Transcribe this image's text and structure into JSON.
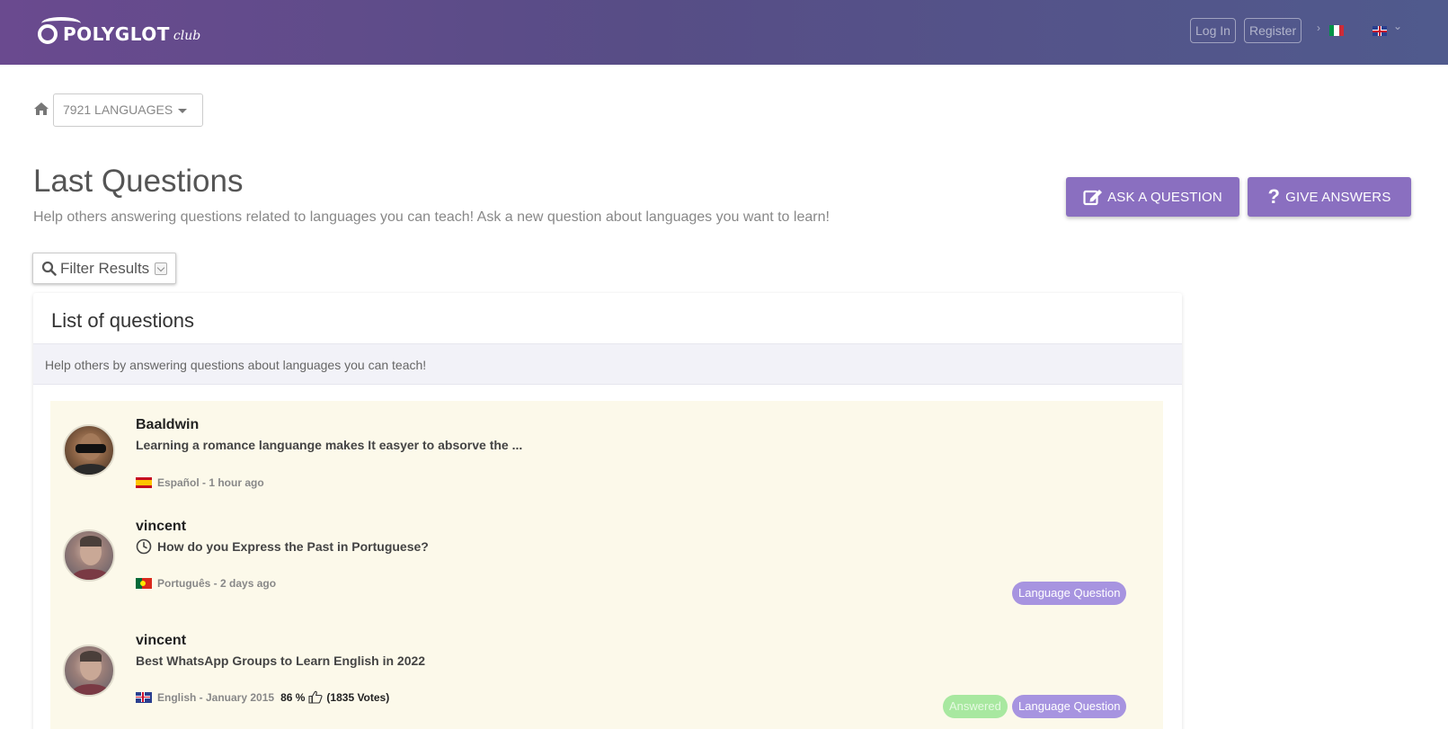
{
  "header": {
    "logo_text": "POLYGLOT",
    "logo_sub": "club",
    "login_label": "Log In",
    "register_label": "Register",
    "chevron": "›",
    "lang_chevron": "⌄"
  },
  "breadcrumb": {
    "languages_label": "7921 LANGUAGES"
  },
  "page": {
    "title": "Last Questions",
    "subtitle": "Help others answering questions related to languages you can teach! Ask a new question about languages you want to learn!",
    "ask_label": "ASK A QUESTION",
    "give_label": "GIVE ANSWERS"
  },
  "filter": {
    "label": "Filter Results"
  },
  "panel": {
    "title": "List of questions",
    "hint": "Help others by answering questions about languages you can teach!"
  },
  "questions": [
    {
      "user": "Baaldwin",
      "text": "Learning a romance languange makes It easyer to absorve the ...",
      "meta": "Español - 1 hour ago",
      "flag": "es-flag-icon"
    },
    {
      "user": "vincent",
      "text": "How do you Express the Past in Portuguese?",
      "meta": "Português - 2 days ago",
      "flag": "pt-flag-icon",
      "tag": "Language Question"
    },
    {
      "user": "vincent",
      "text": "Best WhatsApp Groups to Learn English in 2022",
      "meta": "English - January 2015",
      "flag": "uk-flag-icon",
      "rating_percent": "86 %",
      "votes": "(1835 Votes)",
      "status": "Answered",
      "tag": "Language Question"
    }
  ],
  "colors": {
    "accent": "#8a6fc0",
    "header_start": "#6a4a8f",
    "header_end": "#505a8d",
    "list_bg": "#fcf9ea",
    "tag_lang": "#a794e0",
    "tag_answered": "#a8e8a0"
  }
}
